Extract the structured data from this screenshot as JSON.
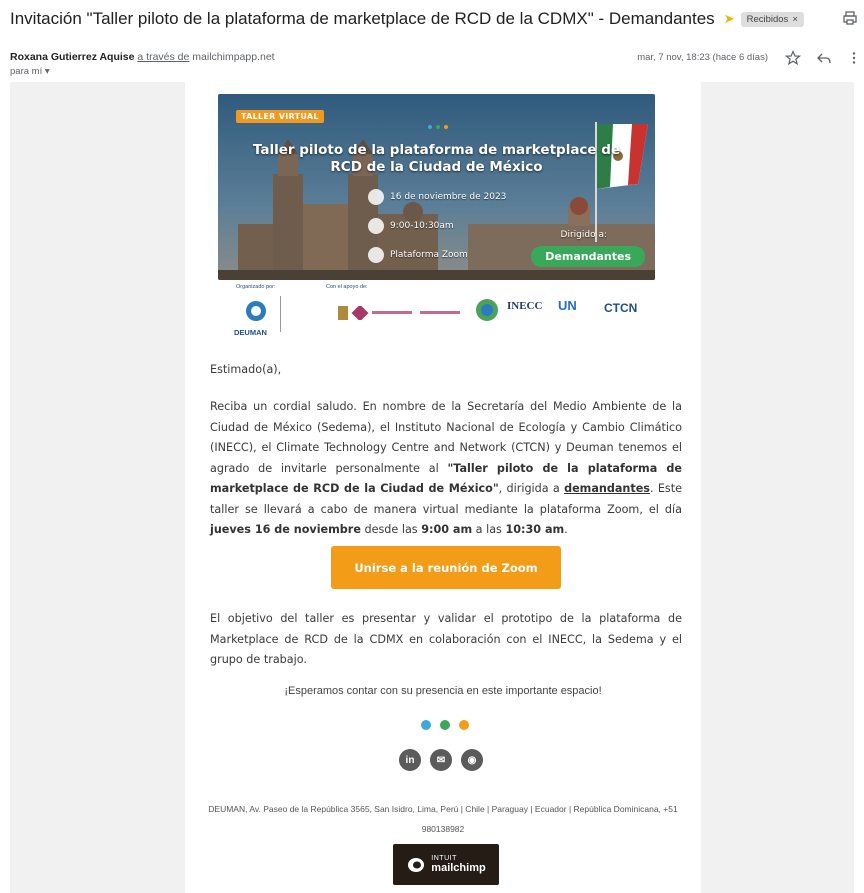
{
  "email": {
    "subject": "Invitación \"Taller piloto de la plataforma de marketplace de RCD de la CDMX\" - Demandantes",
    "label": "Recibidos",
    "sender_name": "Roxana Gutierrez Aquise",
    "via_text": "a través de",
    "via_domain": "mailchimpapp.net",
    "to": "para mí",
    "date": "mar, 7 nov, 18:23 (hace 6 días)"
  },
  "banner": {
    "tag": "TALLER VIRTUAL",
    "title": "Taller piloto de la plataforma de marketplace de RCD de la Ciudad de México",
    "date": "16 de noviembre de 2023",
    "time": "9:00-10:30am",
    "platform": "Plataforma Zoom",
    "dirigido": "Dirigido a:",
    "audience": "Demandantes"
  },
  "logos": {
    "organizado": "Organizado por:",
    "apoyo": "Con el apoyo de:",
    "deuman": "DEUMAN",
    "inecc": "INECC",
    "un": "UN",
    "ctcn": "CTCN"
  },
  "body": {
    "greeting": "Estimado(a),",
    "p1_a": "Reciba un cordial saludo. En nombre de la Secretaría del Medio Ambiente de la Ciudad de México (Sedema), el Instituto Nacional de Ecología y Cambio Climático (INECC), el Climate Technology Centre and Network (CTCN) y Deuman tenemos el agrado de invitarle personalmente al ",
    "p1_b": "\"Taller piloto de la plataforma de marketplace de RCD de la Ciudad de México\"",
    "p1_c": ", dirigida a ",
    "p1_d": "demandantes",
    "p1_e": ". Este taller se llevará a cabo de manera virtual mediante la plataforma Zoom, el día ",
    "p1_f": "jueves 16 de noviembre",
    "p1_g": " desde las ",
    "p1_h": "9:00 am",
    "p1_i": " a las ",
    "p1_j": "10:30 am",
    "p1_k": ".",
    "button": "Unirse a la reunión de Zoom",
    "p2": "El objetivo del taller es presentar y validar el prototipo de la plataforma de Marketplace de RCD de la CDMX en colaboración con el INECC, la Sedema y el grupo de trabajo.",
    "closing": "¡Esperamos contar con su presencia en este importante espacio!",
    "footer": "DEUMAN, Av. Paseo de la República 3565, San Isidro, Lima, Perú | Chile | Paraguay | Ecuador | República Dominicana, +51 980138982",
    "mc_small": "INTUIT",
    "mc_big": "mailchimp"
  },
  "colors": {
    "accent_orange": "#f39c18",
    "dot_blue": "#3fa9d6",
    "dot_green": "#3aa85a",
    "dot_orange": "#f39c18"
  }
}
